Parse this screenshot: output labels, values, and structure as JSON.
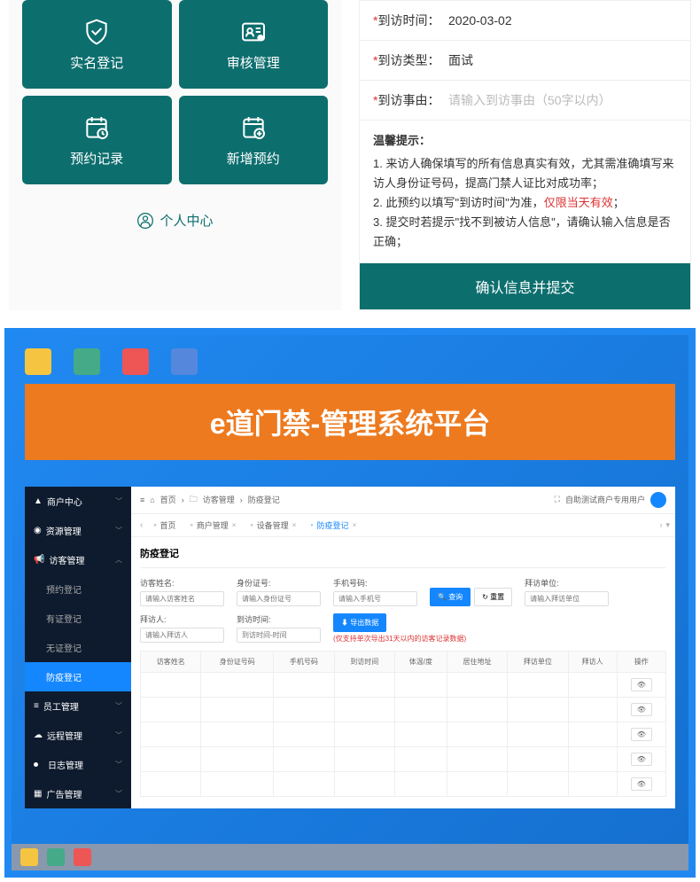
{
  "mobile": {
    "tiles": [
      {
        "label": "实名登记"
      },
      {
        "label": "审核管理"
      },
      {
        "label": "预约记录"
      },
      {
        "label": "新增预约"
      }
    ],
    "personal_center": "个人中心"
  },
  "form": {
    "visit_time_label": "到访时间：",
    "visit_time_value": "2020-03-02",
    "visit_type_label": "到访类型：",
    "visit_type_value": "面试",
    "visit_reason_label": "到访事由：",
    "visit_reason_placeholder": "请输入到访事由（50字以内）",
    "tips_title": "温馨提示：",
    "tip1": "1. 来访人确保填写的所有信息真实有效，尤其需准确填写来访人身份证号码，提高门禁人证比对成功率；",
    "tip2_a": "2. 此预约以填写\"到访时间\"为准，",
    "tip2_b": "仅限当天有效",
    "tip2_c": "；",
    "tip3": "3. 提交时若提示\"找不到被访人信息\"，请确认输入信息是否正确；",
    "submit": "确认信息并提交"
  },
  "banner": "e道门禁-管理系统平台",
  "admin": {
    "sidebar": {
      "items": [
        {
          "label": "商户中心",
          "icon": "user"
        },
        {
          "label": "资源管理",
          "icon": "globe"
        },
        {
          "label": "访客管理",
          "icon": "speaker",
          "expanded": true
        },
        {
          "label": "员工管理",
          "icon": "bars"
        },
        {
          "label": "远程管理",
          "icon": "cloud"
        },
        {
          "label": "日志管理",
          "icon": "dot"
        },
        {
          "label": "广告管理",
          "icon": "grid"
        }
      ],
      "subs": [
        {
          "label": "预约登记"
        },
        {
          "label": "有证登记"
        },
        {
          "label": "无证登记"
        },
        {
          "label": "防疫登记",
          "active": true
        }
      ]
    },
    "breadcrumb": {
      "home": "首页",
      "mid": "访客管理",
      "last": "防疫登记"
    },
    "user_label": "自助测试商户专用用户",
    "tabs": [
      {
        "label": "首页"
      },
      {
        "label": "商户管理"
      },
      {
        "label": "设备管理"
      },
      {
        "label": "防疫登记",
        "active": true
      }
    ],
    "section_title": "防疫登记",
    "fields": {
      "visitor_name": {
        "label": "访客姓名:",
        "placeholder": "请输入访客姓名"
      },
      "id_no": {
        "label": "身份证号:",
        "placeholder": "请输入身份证号"
      },
      "phone": {
        "label": "手机号码:",
        "placeholder": "请输入手机号"
      },
      "visit_unit": {
        "label": "拜访单位:",
        "placeholder": "请输入拜访单位"
      },
      "visit_person": {
        "label": "拜访人:",
        "placeholder": "请输入拜访人"
      },
      "arrive_time": {
        "label": "到访时间:",
        "placeholder": "到访时间-时间"
      }
    },
    "btn_search": "查询",
    "btn_reset": "重置",
    "btn_export": "导出数据",
    "export_hint": "(仅支持单次导出31天以内的访客记录数据)",
    "columns": [
      "访客姓名",
      "身份证号码",
      "手机号码",
      "到访时间",
      "体温/度",
      "居住地址",
      "拜访单位",
      "拜访人",
      "操作"
    ]
  }
}
